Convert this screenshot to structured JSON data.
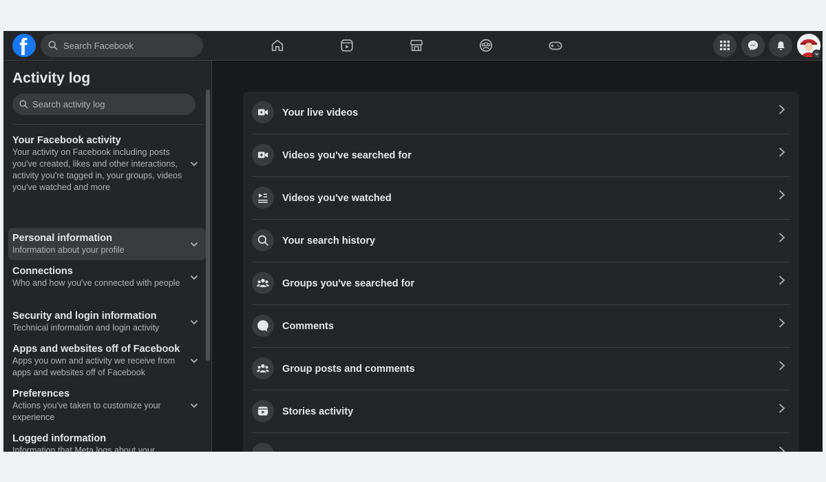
{
  "topbar": {
    "search_placeholder": "Search Facebook",
    "nav_icons": [
      "home-icon",
      "video-icon",
      "marketplace-icon",
      "groups-icon",
      "gaming-icon"
    ],
    "right_icons": [
      "menu-grid-icon",
      "messenger-icon",
      "notifications-icon"
    ],
    "brand_color": "#1877f2"
  },
  "sidebar": {
    "title": "Activity log",
    "search_placeholder": "Search activity log",
    "items": [
      {
        "label": "Your Facebook activity",
        "desc": "Your activity on Facebook including posts you've created, likes and other interactions, activity you're tagged in, your groups, videos you've watched and more"
      },
      {
        "label": "Personal information",
        "desc": "Information about your profile"
      },
      {
        "label": "Connections",
        "desc": "Who and how you've connected with people"
      },
      {
        "label": "Security and login information",
        "desc": "Technical information and login activity"
      },
      {
        "label": "Apps and websites off of Facebook",
        "desc": "Apps you own and activity we receive from apps and websites off of Facebook"
      },
      {
        "label": "Preferences",
        "desc": "Actions you've taken to customize your experience"
      },
      {
        "label": "Logged information",
        "desc": "Information that Meta logs about your activity, including things like your location and search history"
      }
    ]
  },
  "main": {
    "rows": [
      {
        "label": "Your live videos",
        "icon": "live-video-icon"
      },
      {
        "label": "Videos you've searched for",
        "icon": "video-search-icon"
      },
      {
        "label": "Videos you've watched",
        "icon": "watched-videos-icon"
      },
      {
        "label": "Your search history",
        "icon": "search-icon"
      },
      {
        "label": "Groups you've searched for",
        "icon": "groups-icon"
      },
      {
        "label": "Comments",
        "icon": "comment-icon"
      },
      {
        "label": "Group posts and comments",
        "icon": "groups-icon"
      },
      {
        "label": "Stories activity",
        "icon": "stories-icon"
      }
    ]
  }
}
